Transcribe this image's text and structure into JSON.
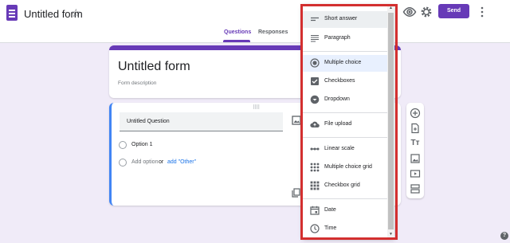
{
  "header": {
    "title": "Untitled form",
    "send_label": "Send",
    "tabs": [
      {
        "label": "Questions",
        "active": true
      },
      {
        "label": "Responses",
        "active": false
      }
    ]
  },
  "form": {
    "title": "Untitled form",
    "description_placeholder": "Form description"
  },
  "question": {
    "title": "Untitled Question",
    "options": [
      "Option 1"
    ],
    "add_option": "Add option",
    "or": "or",
    "add_other": "add \"Other\""
  },
  "question_type_menu": {
    "items": [
      {
        "label": "Short answer",
        "icon": "short-answer-icon"
      },
      {
        "label": "Paragraph",
        "icon": "paragraph-icon"
      },
      {
        "label": "Multiple choice",
        "icon": "radio-icon",
        "selected": true
      },
      {
        "label": "Checkboxes",
        "icon": "checkbox-icon"
      },
      {
        "label": "Dropdown",
        "icon": "dropdown-icon"
      },
      {
        "label": "File upload",
        "icon": "cloud-upload-icon"
      },
      {
        "label": "Linear scale",
        "icon": "linear-scale-icon"
      },
      {
        "label": "Multiple choice grid",
        "icon": "grid-icon"
      },
      {
        "label": "Checkbox grid",
        "icon": "grid-icon"
      },
      {
        "label": "Date",
        "icon": "calendar-icon"
      },
      {
        "label": "Time",
        "icon": "clock-icon"
      }
    ]
  },
  "side_toolbar": [
    "add-question-icon",
    "import-questions-icon",
    "add-title-icon",
    "add-image-icon",
    "add-video-icon",
    "add-section-icon"
  ],
  "help_glyph": "?",
  "colors": {
    "brand": "#673ab7",
    "accent": "#4285f4",
    "highlight_box": "#d32f2f",
    "background": "#f0ebf8"
  }
}
